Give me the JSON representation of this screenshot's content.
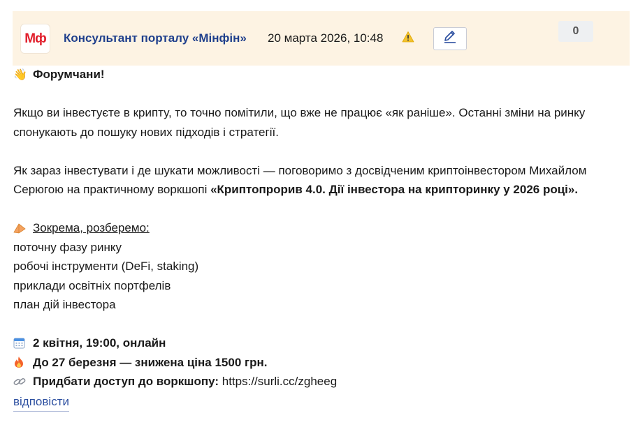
{
  "header": {
    "logo_text": "Мф",
    "author": "Консультант порталу «Мінфін»",
    "date": "20 марта 2026, 10:48",
    "rating": "0",
    "warn_icon": "warning-icon",
    "edit_icon": "pencil-icon",
    "colors": {
      "header_bg": "#fdf3e3",
      "author": "#1f3f8c",
      "logo": "#e11d2a",
      "link": "#2c4fa0"
    }
  },
  "post": {
    "greeting": "Форумчани!",
    "p1_l1": "Якщо ви інвестуєте в крипту, то точно помітили, що вже не працює «як раніше». Останні зміни на ринку",
    "p1_l2": "спонукають до пошуку нових підходів і стратегії.",
    "p2_l1": "Як зараз інвестувати і де шукати можливості — поговоримо з досвідченим криптоінвестором Михайлом",
    "p2_l2_pre": "Серюгою на практичному воркшопі ",
    "p2_l2_bold": "«Криптопрорив 4.0. Дії інвестора на крипторинку у 2026 році».",
    "list_heading": "Зокрема, розберемо:",
    "list_items": [
      "поточну фазу ринку",
      "робочі інструменти (DeFi, staking)",
      "приклади освітніх портфелів",
      "план дій інвестора"
    ],
    "event_date": "2 квітня, 19:00, онлайн",
    "price": "До 27 березня — знижена ціна 1500 грн.",
    "access_label": "Придбати доступ до воркшопу:",
    "access_url": " https://surli.cc/zgheeg"
  },
  "reply": {
    "label": "відповісти"
  }
}
